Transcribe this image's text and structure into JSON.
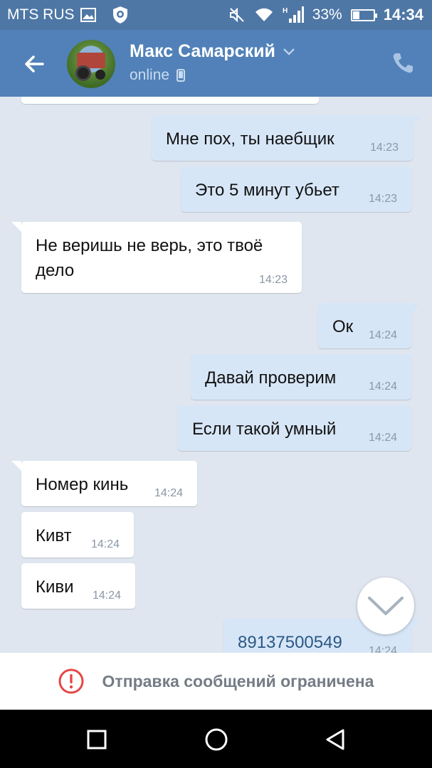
{
  "status_bar": {
    "carrier": "MTS RUS",
    "battery": "33%",
    "battery_level": 0.33,
    "time": "14:34",
    "icons": [
      "image-icon",
      "shield-icon",
      "mute-icon",
      "wifi-icon",
      "signal-icon",
      "battery-icon"
    ]
  },
  "header": {
    "name": "Макс Самарский",
    "status": "online",
    "icons": [
      "back-arrow-icon",
      "chevron-down-icon",
      "mobile-icon",
      "phone-icon"
    ]
  },
  "messages": [
    {
      "text": "Мне пох, ты наебщик",
      "time": "14:23",
      "dir": "out"
    },
    {
      "text": "Это 5 минут убьет",
      "time": "14:23",
      "dir": "out"
    },
    {
      "text": "Не веришь не верь, это твоё дело",
      "time": "14:23",
      "dir": "in"
    },
    {
      "text": "Ок",
      "time": "14:24",
      "dir": "out"
    },
    {
      "text": "Давай проверим",
      "time": "14:24",
      "dir": "out"
    },
    {
      "text": "Если такой умный",
      "time": "14:24",
      "dir": "out"
    },
    {
      "text": "Номер кинь",
      "time": "14:24",
      "dir": "in"
    },
    {
      "text": "Кивт",
      "time": "14:24",
      "dir": "in"
    },
    {
      "text": "Киви",
      "time": "14:24",
      "dir": "in"
    },
    {
      "text": "89137500549",
      "time": "14:24",
      "dir": "out"
    }
  ],
  "restriction": {
    "text": "Отправка сообщений ограничена",
    "icon": "exclamation-circle-icon",
    "icon_color": "#e64646"
  },
  "nav": {
    "icons": [
      "recents-square-icon",
      "home-circle-icon",
      "back-triangle-icon"
    ]
  },
  "colors": {
    "header": "#5181b8",
    "status_bar": "#4e77a5",
    "chat_bg": "#dfe6ef",
    "bubble_out": "#d7e6f7",
    "bubble_in": "#ffffff",
    "link": "#2a5885"
  }
}
